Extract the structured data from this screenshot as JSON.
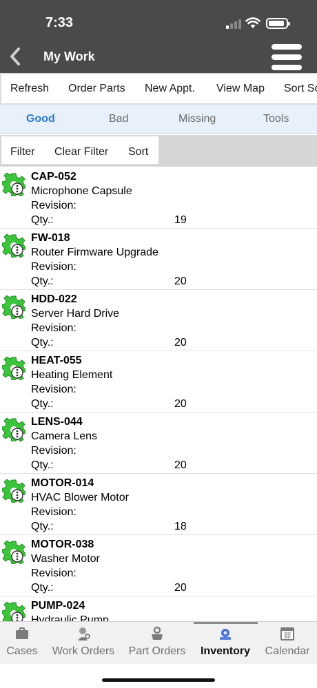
{
  "status": {
    "time": "7:33"
  },
  "header": {
    "title": "My Work"
  },
  "actions": [
    "Refresh",
    "Order Parts",
    "New Appt.",
    "View Map",
    "Sort So"
  ],
  "tabs": [
    "Good",
    "Bad",
    "Missing",
    "Tools"
  ],
  "active_tab": "Good",
  "filter": {
    "filter": "Filter",
    "clear": "Clear Filter",
    "sort": "Sort"
  },
  "labels": {
    "revision": "Revision:",
    "qty": "Qty.:"
  },
  "items": [
    {
      "code": "CAP-052",
      "name": "Microphone Capsule",
      "qty": "19"
    },
    {
      "code": "FW-018",
      "name": "Router Firmware Upgrade",
      "qty": "20"
    },
    {
      "code": "HDD-022",
      "name": "Server Hard Drive",
      "qty": "20"
    },
    {
      "code": "HEAT-055",
      "name": "Heating Element",
      "qty": "20"
    },
    {
      "code": "LENS-044",
      "name": "Camera Lens",
      "qty": "20"
    },
    {
      "code": "MOTOR-014",
      "name": "HVAC Blower Motor",
      "qty": "18"
    },
    {
      "code": "MOTOR-038",
      "name": "Washer Motor",
      "qty": "20"
    },
    {
      "code": "PUMP-024",
      "name": "Hydraulic Pump",
      "qty": ""
    }
  ],
  "nav": [
    "Cases",
    "Work Orders",
    "Part Orders",
    "Inventory",
    "Calendar"
  ],
  "active_nav": "Inventory",
  "colors": {
    "header": "#4a4a4a",
    "accent": "#2a7ad4",
    "gear": "#3cc43c"
  }
}
